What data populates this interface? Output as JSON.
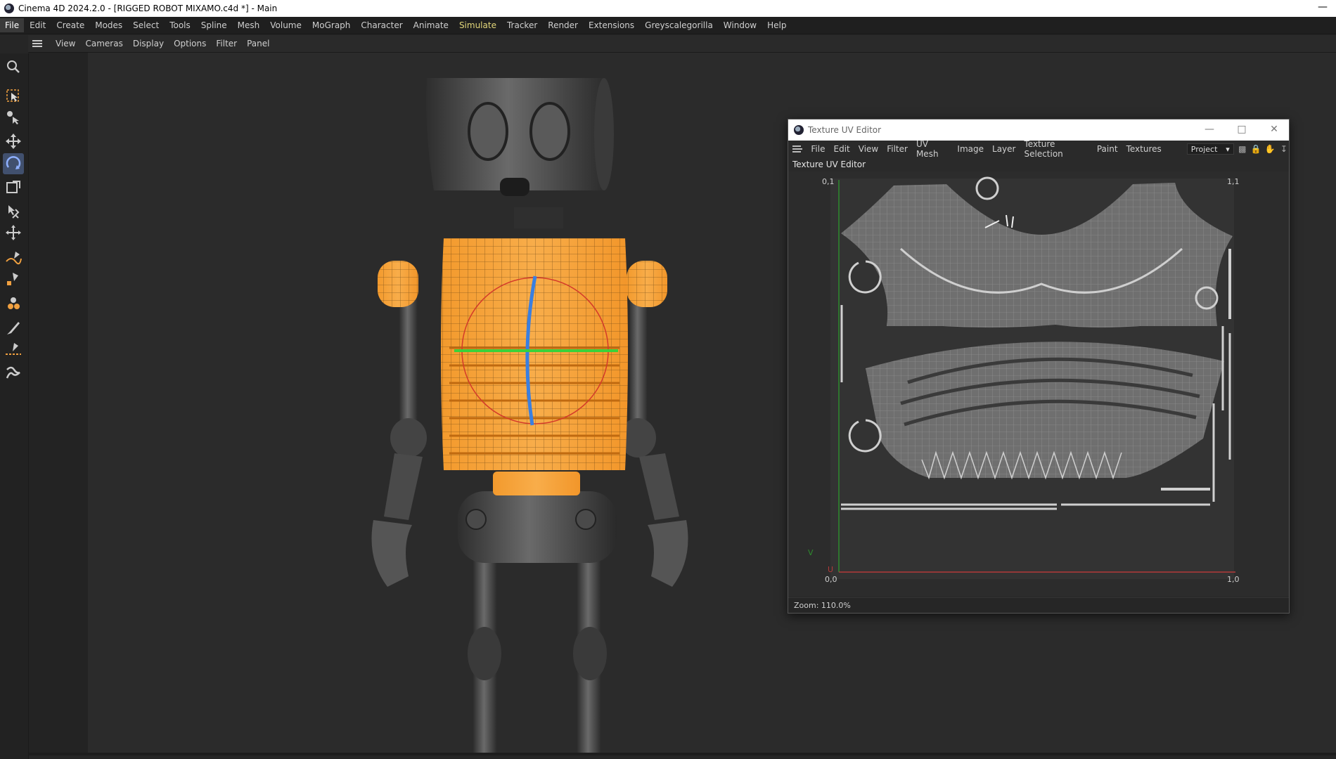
{
  "window": {
    "title": "Cinema 4D 2024.2.0 - [RIGGED ROBOT MIXAMO.c4d *] - Main",
    "minimize_glyph": "—"
  },
  "menubar": {
    "items": [
      "File",
      "Edit",
      "Create",
      "Modes",
      "Select",
      "Tools",
      "Spline",
      "Mesh",
      "Volume",
      "MoGraph",
      "Character",
      "Animate",
      "Simulate",
      "Tracker",
      "Render",
      "Extensions",
      "Greyscalegorilla",
      "Window",
      "Help"
    ],
    "active": "File",
    "highlight": "Simulate"
  },
  "viewport_menu": {
    "items": [
      "View",
      "Cameras",
      "Display",
      "Options",
      "Filter",
      "Panel"
    ]
  },
  "toolbar": {
    "tools": [
      "search-icon",
      "live-selection-icon",
      "select-tools-icon",
      "move-icon",
      "rotate-icon",
      "scale-icon",
      "transform-icon",
      "snap-move-icon",
      "spline-pen-icon",
      "paint-icon",
      "fill-icon",
      "brush-icon",
      "knife-icon",
      "sculpt-icon"
    ],
    "active_tool": "rotate-icon"
  },
  "colors": {
    "selection_orange": "#f7a035",
    "axis_x": "#e23b3b",
    "axis_y": "#3ad13a",
    "axis_z": "#3a7fe0",
    "uv_mesh": "#a8a8a8",
    "uv_axis_v": "#2e8b2e",
    "uv_axis_u": "#b33a3a"
  },
  "uv_editor": {
    "title": "Texture UV Editor",
    "panel_title": "Texture UV Editor",
    "menu": [
      "File",
      "Edit",
      "View",
      "Filter",
      "UV Mesh",
      "Image",
      "Layer",
      "Texture Selection",
      "Paint",
      "Textures"
    ],
    "dropdown_value": "Project",
    "icons": [
      "histogram-icon",
      "lock-icon",
      "hand-icon",
      "pin-icon"
    ],
    "corner_labels": {
      "top_left": "0,1",
      "top_right": "1,1",
      "bottom_left": "0,0",
      "bottom_right": "1,0",
      "axis_v": "V",
      "axis_u": "U"
    },
    "zoom": "Zoom: 110.0%"
  }
}
